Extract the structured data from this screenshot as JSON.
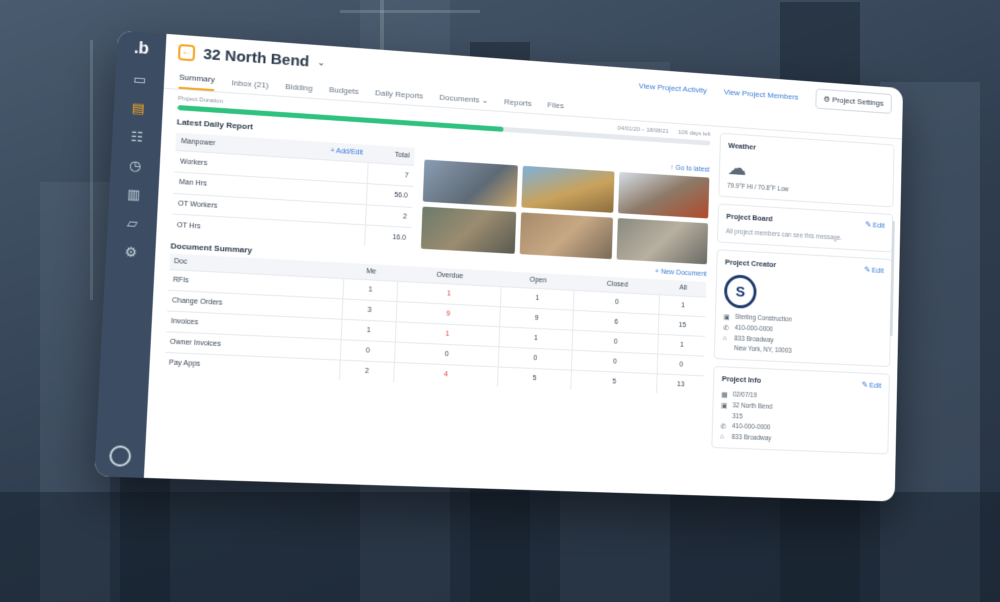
{
  "app": {
    "logo": ".b"
  },
  "header": {
    "back_icon": "arrow-left-icon",
    "project_name": "32 North Bend",
    "caret": "⌄",
    "view_activity": "View Project Activity",
    "view_members": "View Project Members",
    "settings": "⚙ Project Settings"
  },
  "tabs": [
    "Summary",
    "Inbox (21)",
    "Bidding",
    "Budgets",
    "Daily Reports",
    "Documents ⌄",
    "Reports",
    "Files"
  ],
  "duration": {
    "label": "Project Duration",
    "dates": "04/01/20 – 18/08/21",
    "left": "106 days left",
    "progress": 0.6
  },
  "daily_report": {
    "title": "Latest Daily Report",
    "goto": "↑ Go to latest",
    "header": {
      "name": "Manpower",
      "add": "+ Add/Edit",
      "total": "Total"
    },
    "rows": [
      {
        "label": "Workers",
        "value": "7"
      },
      {
        "label": "Man Hrs",
        "value": "56.0"
      },
      {
        "label": "OT Workers",
        "value": "2"
      },
      {
        "label": "OT Hrs",
        "value": "16.0"
      }
    ]
  },
  "documents": {
    "title": "Document Summary",
    "new": "+ New Document",
    "columns": [
      "Doc",
      "Me",
      "Overdue",
      "Open",
      "Closed",
      "All"
    ],
    "rows": [
      [
        "RFIs",
        "1",
        "1",
        "1",
        "0",
        "1"
      ],
      [
        "Change Orders",
        "3",
        "9",
        "9",
        "6",
        "15"
      ],
      [
        "Invoices",
        "1",
        "1",
        "1",
        "0",
        "1"
      ],
      [
        "Owner Invoices",
        "0",
        "0",
        "0",
        "0",
        "0"
      ],
      [
        "Pay Apps",
        "2",
        "4",
        "5",
        "5",
        "13"
      ]
    ]
  },
  "weather": {
    "title": "Weather",
    "icon": "cloud-icon",
    "temp": "79.9°F Hi / 70.8°F Low"
  },
  "project_board": {
    "title": "Project Board",
    "edit": "✎ Edit",
    "message": "All project members can see this message."
  },
  "project_creator": {
    "title": "Project Creator",
    "edit": "✎ Edit",
    "initial": "S",
    "company": "Sterling Construction",
    "phone": "410-000-0000",
    "address1": "833 Broadway",
    "address2": "New York, NY, 10003"
  },
  "project_info": {
    "title": "Project Info",
    "edit": "✎ Edit",
    "date": "02/07/19",
    "name1": "32 North Bend",
    "name2": "315",
    "phone": "410-000-0000",
    "address": "833 Broadway"
  },
  "colors": {
    "accent": "#f5a623",
    "link": "#3b7dd8",
    "progress": "#2ec27e",
    "rail": "#3c4d63",
    "overdue": "#e0403a"
  }
}
